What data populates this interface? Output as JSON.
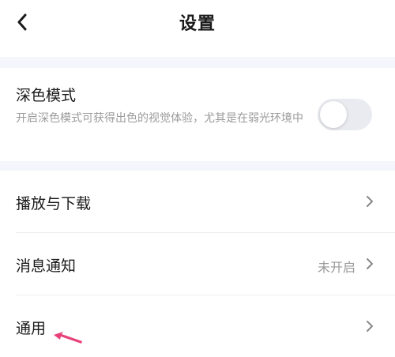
{
  "header": {
    "title": "设置",
    "back_icon": "chevron-left-icon"
  },
  "dark_mode": {
    "title": "深色模式",
    "description": "开启深色模式可获得出色的视觉体验，尤其是在弱光环境中",
    "enabled": false
  },
  "settings_list": [
    {
      "label": "播放与下载",
      "value": "",
      "icon": "chevron-right-icon"
    },
    {
      "label": "消息通知",
      "value": "未开启",
      "icon": "chevron-right-icon"
    },
    {
      "label": "通用",
      "value": "",
      "icon": "chevron-right-icon"
    }
  ],
  "colors": {
    "page_background": "#f3f6fb",
    "annotation_arrow": "#e8417a"
  }
}
